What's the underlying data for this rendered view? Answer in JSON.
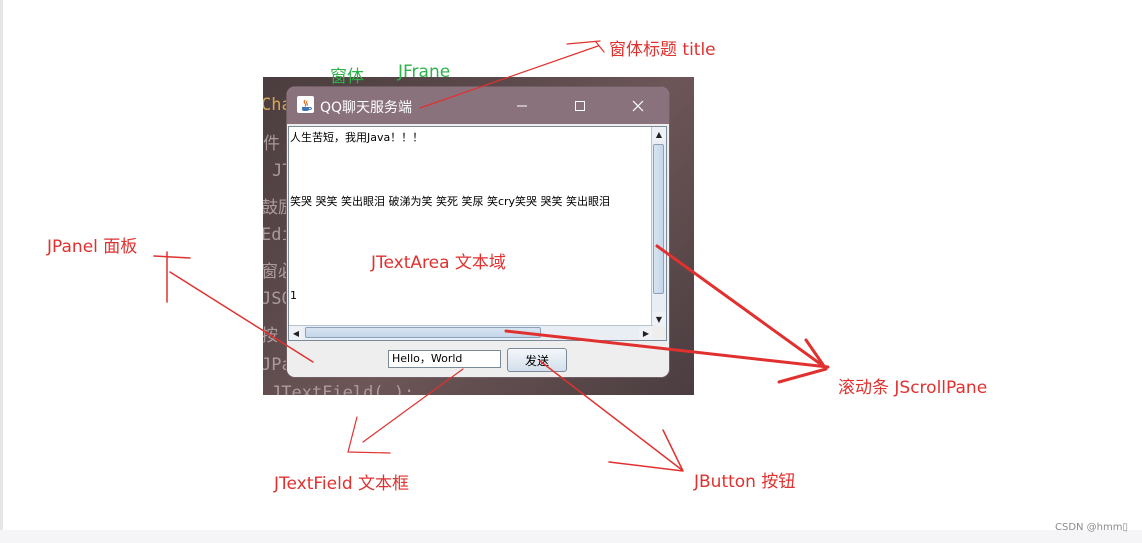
{
  "window": {
    "title": "QQ聊天服务端",
    "minimize_icon": "minimize-icon",
    "maximize_icon": "maximize-icon",
    "close_icon": "close-icon",
    "titlebar_color": "#8a727d"
  },
  "textarea": {
    "lines": [
      "人生苦短，我用Java！！！",
      "      笑哭 哭笑 笑出眼泪 破涕为笑 笑死 笑尿 笑cry笑哭 哭笑 笑出眼泪",
      "1"
    ]
  },
  "panel": {
    "textfield_value": "Hello，World",
    "send_label": "发送"
  },
  "background_fragments": [
    "Cha",
    "件",
    "JT",
    "鼓励",
    "Edi",
    "窗必",
    "JSO",
    "按",
    "JPa",
    "JTextField(     );"
  ],
  "annotations": {
    "frame_label": "窗体",
    "jframe": "JFrane",
    "title_label": "窗体标题 title",
    "jpanel": "JPanel  面板",
    "jtextarea": "JTextArea  文本域",
    "jscrollpane": "滚动条   JScrollPane",
    "jtextfield": "JTextField  文本框",
    "jbutton": "JButton  按钮"
  },
  "watermark": "CSDN @hmm▯",
  "colors": {
    "annotation": "#e0312f",
    "annotation_green": "#2db34a"
  }
}
